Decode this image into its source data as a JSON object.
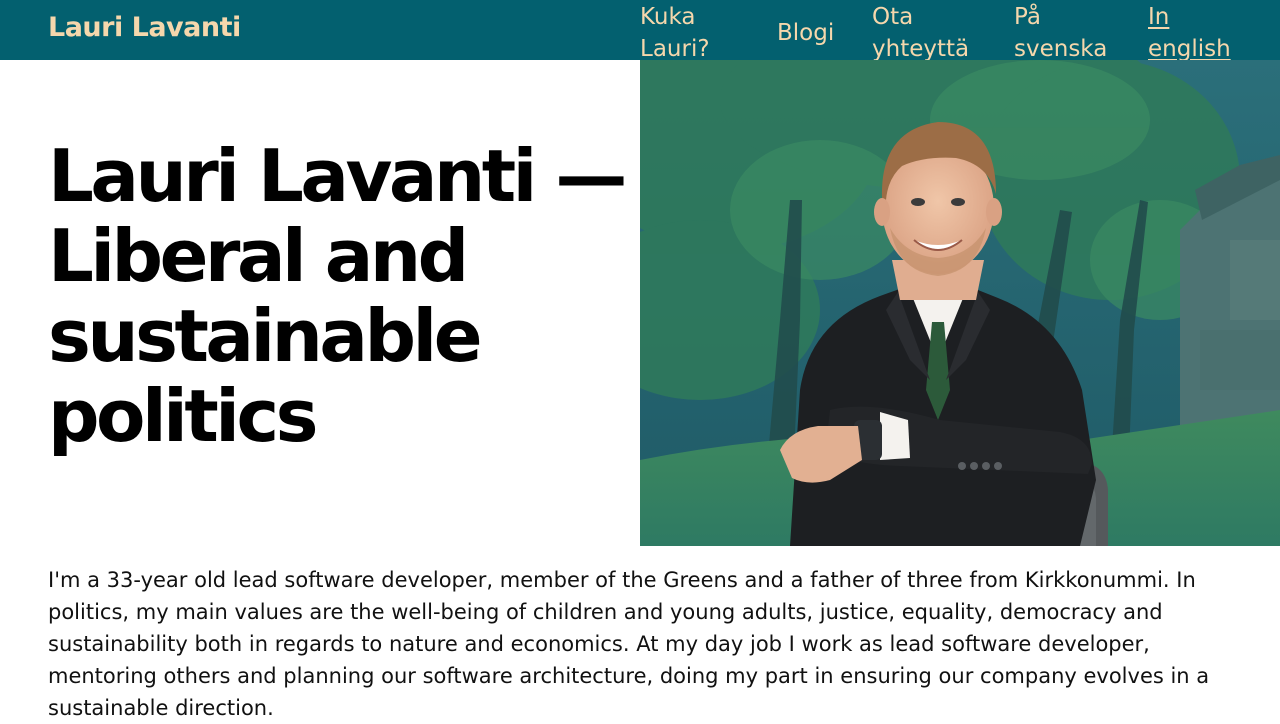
{
  "header": {
    "brand": "Lauri Lavanti",
    "nav": [
      {
        "label": "Kuka Lauri?"
      },
      {
        "label": "Blogi"
      },
      {
        "label": "Ota yhteyttä"
      },
      {
        "label": "På svenska"
      },
      {
        "label": "In english",
        "current": true
      }
    ]
  },
  "hero": {
    "title": "Lauri Lavanti — Liberal and sustainable politics",
    "image": {
      "subject": "portrait-photo"
    }
  },
  "intro": {
    "text": "I'm a 33-year old lead software developer, member of the Greens and a father of three from Kirkkonummi. In politics, my main values are the well-being of children and young adults, justice, equality, democracy and sustainability both in regards to nature and economics. At my day job I work as lead software developer, mentoring others and planning our software architecture, doing my part in ensuring our company evolves in a sustainable direction."
  },
  "colors": {
    "header_bg": "#03606f",
    "header_text": "#f5d7ac",
    "body_text": "#111111"
  }
}
